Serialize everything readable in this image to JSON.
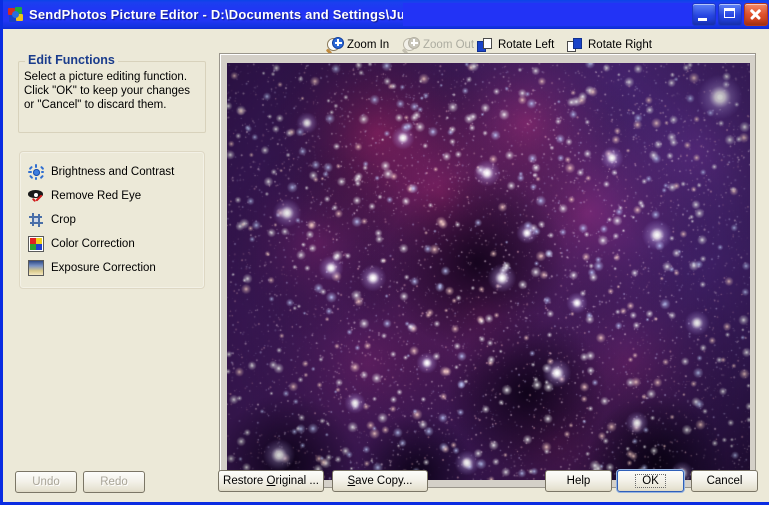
{
  "window": {
    "title": "SendPhotos Picture Editor - D:\\Documents and Settings\\Julia",
    "app_icon": "pinwheel-icon",
    "controls": {
      "minimize": "minimize-button",
      "maximize": "maximize-button",
      "close": "close-button"
    },
    "colors": {
      "title_bar_blue": "#2233f6",
      "window_border": "#0a2ce2",
      "face": "#ece9d8",
      "viewer_face": "#d4d0c8",
      "heading_blue": "#1a3c8c",
      "close_red": "#e0512b"
    }
  },
  "toolbar": {
    "items": [
      {
        "label": "Zoom In",
        "icon": "zoom-in-icon",
        "enabled": true
      },
      {
        "label": "Zoom Out",
        "icon": "zoom-out-icon",
        "enabled": false
      },
      {
        "label": "Rotate Left",
        "icon": "rotate-left-icon",
        "enabled": true
      },
      {
        "label": "Rotate Right",
        "icon": "rotate-right-icon",
        "enabled": true
      }
    ]
  },
  "sidebar": {
    "group_title": "Edit Functions",
    "description_line1": "Select a picture editing function.",
    "description_line2": "Click \"OK\" to keep your changes",
    "description_line3": "or \"Cancel\" to discard them.",
    "functions": [
      {
        "label": "Brightness and Contrast",
        "icon": "brightness-icon"
      },
      {
        "label": "Remove Red Eye",
        "icon": "red-eye-icon"
      },
      {
        "label": "Crop",
        "icon": "crop-icon"
      },
      {
        "label": "Color Correction",
        "icon": "color-correction-icon"
      },
      {
        "label": "Exposure Correction",
        "icon": "exposure-correction-icon"
      }
    ]
  },
  "viewer": {
    "image_description": "North America Nebula star field photograph"
  },
  "footer": {
    "undo": "Undo",
    "redo": "Redo",
    "restore_original": "Restore Original ...",
    "save_copy": "Save Copy...",
    "help": "Help",
    "ok": "OK",
    "cancel": "Cancel"
  }
}
